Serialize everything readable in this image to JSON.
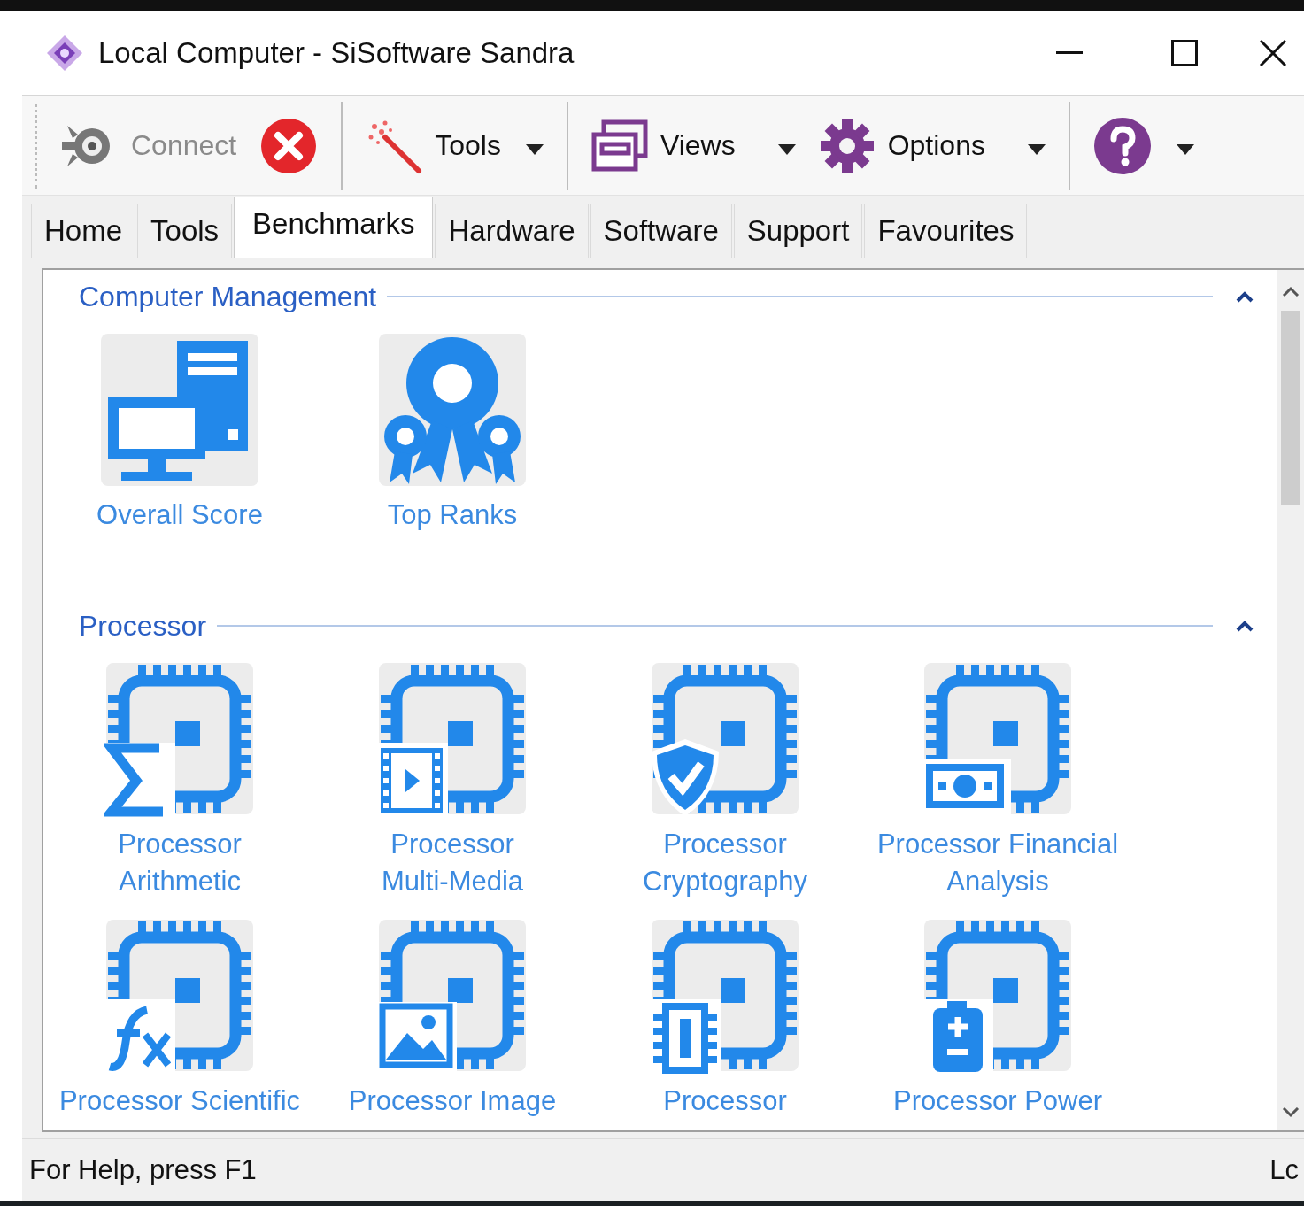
{
  "window": {
    "title": "Local Computer - SiSoftware Sandra"
  },
  "toolbar": {
    "groups": [
      {
        "items": [
          {
            "kind": "connect",
            "label": "Connect",
            "disabled": true,
            "dropdown": false
          },
          {
            "kind": "stop",
            "disabled": false,
            "dropdown": false
          }
        ]
      },
      {
        "items": [
          {
            "kind": "tools",
            "label": "Tools",
            "disabled": false,
            "dropdown": true
          }
        ]
      },
      {
        "items": [
          {
            "kind": "views",
            "label": "Views",
            "disabled": false,
            "dropdown": true
          },
          {
            "kind": "options",
            "label": "Options",
            "disabled": false,
            "dropdown": true
          }
        ]
      },
      {
        "items": [
          {
            "kind": "help",
            "disabled": false,
            "dropdown": true
          }
        ]
      }
    ]
  },
  "tabs": [
    {
      "label": "Home",
      "selected": false
    },
    {
      "label": "Tools",
      "selected": false
    },
    {
      "label": "Benchmarks",
      "selected": true
    },
    {
      "label": "Hardware",
      "selected": false
    },
    {
      "label": "Software",
      "selected": false
    },
    {
      "label": "Support",
      "selected": false
    },
    {
      "label": "Favourites",
      "selected": false
    }
  ],
  "sections": [
    {
      "title": "Computer Management",
      "expanded": true,
      "tiles": [
        {
          "label": "Overall Score",
          "kind": "computers"
        },
        {
          "label": "Top Ranks",
          "kind": "ribbon"
        }
      ]
    },
    {
      "title": "Processor",
      "expanded": true,
      "tiles": [
        {
          "label": "Processor\nArithmetic",
          "kind": "sigma"
        },
        {
          "label": "Processor\nMulti-Media",
          "kind": "film"
        },
        {
          "label": "Processor\nCryptography",
          "kind": "shield"
        },
        {
          "label": "Processor Financial\nAnalysis",
          "kind": "money"
        },
        {
          "label": "Processor Scientific",
          "kind": "function"
        },
        {
          "label": "Processor Image",
          "kind": "image"
        },
        {
          "label": "Processor",
          "kind": "chip"
        },
        {
          "label": "Processor Power",
          "kind": "battery"
        }
      ]
    }
  ],
  "status_bar": {
    "text": "For Help, press F1",
    "panel_2": "Lc"
  }
}
